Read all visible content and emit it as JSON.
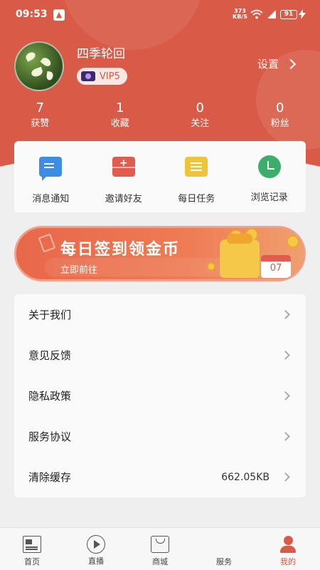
{
  "status_bar": {
    "time": "09:53",
    "net_speed_top": "373",
    "net_speed_bottom": "KB/S",
    "battery": "91"
  },
  "profile": {
    "username": "四季轮回",
    "vip_label": "VIP5",
    "settings_label": "设置"
  },
  "stats": [
    {
      "value": "7",
      "label": "获赞"
    },
    {
      "value": "1",
      "label": "收藏"
    },
    {
      "value": "0",
      "label": "关注"
    },
    {
      "value": "0",
      "label": "粉丝"
    }
  ],
  "quick_actions": [
    {
      "label": "消息通知",
      "icon": "message-icon"
    },
    {
      "label": "邀请好友",
      "icon": "invite-icon"
    },
    {
      "label": "每日任务",
      "icon": "task-icon"
    },
    {
      "label": "浏览记录",
      "icon": "history-icon"
    }
  ],
  "banner": {
    "title": "每日签到领金币",
    "subtitle": "立即前往",
    "calendar_day": "07"
  },
  "menu": [
    {
      "label": "关于我们"
    },
    {
      "label": "意见反馈"
    },
    {
      "label": "隐私政策"
    },
    {
      "label": "服务协议"
    },
    {
      "label": "清除缓存",
      "value": "662.05KB"
    }
  ],
  "tabs": [
    {
      "label": "首页",
      "icon": "home-icon"
    },
    {
      "label": "直播",
      "icon": "live-icon"
    },
    {
      "label": "商城",
      "icon": "mall-icon"
    },
    {
      "label": "服务",
      "icon": "service-icon"
    },
    {
      "label": "我的",
      "icon": "me-icon",
      "active": true
    }
  ],
  "colors": {
    "brand": "#d95a46",
    "background": "#efefef"
  }
}
